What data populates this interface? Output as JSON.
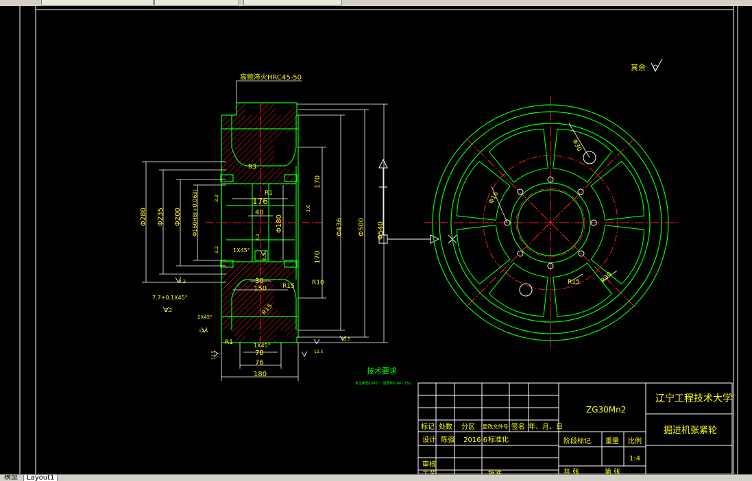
{
  "window": {
    "top_tabs": [
      "",
      "",
      "",
      ""
    ],
    "layout_tabs": [
      "模型",
      "Layout1"
    ]
  },
  "drawing": {
    "heat_treatment_note": "高频淬火HRC45-50",
    "surface_note": "其余",
    "material": "ZG30Mn2",
    "tech_req_title": "技术要求",
    "tech_req_body": "未注倒角1X45°，调质HB240~280。",
    "dims": {
      "d280": "Φ280",
      "d235": "Φ235",
      "d200": "Φ200",
      "d160": "Φ160H8(+0.063)",
      "d180": "Φ180",
      "d436": "Φ436",
      "d500": "Φ500",
      "d540": "Φ540",
      "d16": "Φ16",
      "d30": "Φ30",
      "w176": "176",
      "w40": "40",
      "w30": "30",
      "w150": "150",
      "w70": "70",
      "w76": "76",
      "w180": "180",
      "h170a": "170",
      "h170b": "170",
      "r3": "R3",
      "r1": "R1",
      "r1b": "R1",
      "r15": "R15",
      "r10": "R10",
      "r15b": "R15",
      "r15c": "R15",
      "r30": "R30",
      "ch1": "1X45°",
      "ch2": "1X45°",
      "ch3": "2X45°",
      "thread": "7.7+0.1X45°",
      "ra_32a": "3.2",
      "ra_32b": "3.2",
      "ra_32c": "3.2",
      "ra_32d": "3.2",
      "ra_63": "6.3",
      "ra_125a": "12.5",
      "ra_125b": "12.5",
      "ra_125c": "12.5",
      "ra_125d": "12.5",
      "ra_16": "1.6",
      "ra_32e": "3.2"
    }
  },
  "title_block": {
    "school": "辽宁工程技术大学",
    "part_name": "掘进机张紧轮",
    "material": "ZG30Mn2",
    "h_mark": "标记",
    "h_count": "处数",
    "h_zone": "分区",
    "h_docno": "更改文件号",
    "h_sign": "签名",
    "h_date": "年、月、日",
    "r_design": "设计",
    "designer": "陈强",
    "design_date": "2016.6",
    "std": "标准化",
    "stage": "阶段标记",
    "weight": "重量",
    "scale_label": "比例",
    "scale": "1:4",
    "review": "审核",
    "process": "工艺",
    "approve": "批准",
    "sheets": "共 张",
    "sheet": "第 张"
  },
  "colors": {
    "green": "#00ff00",
    "yellow": "#ffff00",
    "red": "#ff2020",
    "white": "#ffffff"
  }
}
